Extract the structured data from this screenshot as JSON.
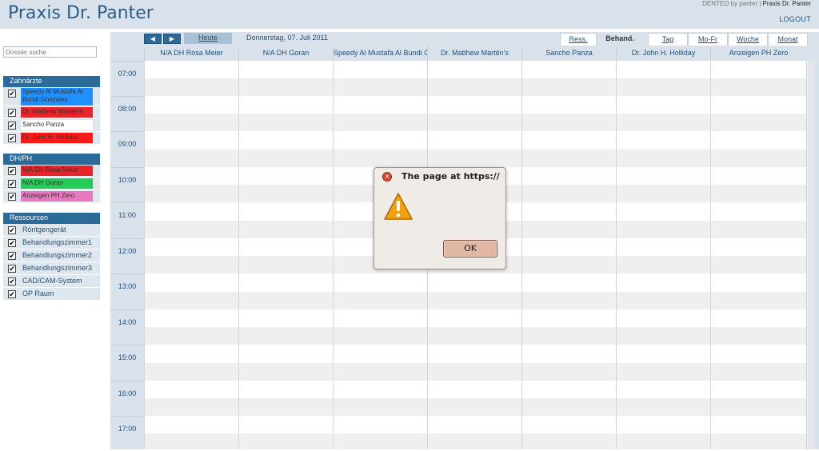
{
  "header": {
    "title": "Praxis Dr. Panter",
    "brand_prefix": "DENTEO by panter",
    "brand_sep": " | ",
    "brand_name": "Praxis Dr. Panter",
    "logout": "LOGOUT"
  },
  "sidebar": {
    "search_placeholder": "Dossier suche",
    "groups": [
      {
        "title": "Zahnärzte",
        "items": [
          {
            "label": "Speedy Al Mustafa Al Bundi Gonzales",
            "color": "#1e90ff",
            "checked": "✔"
          },
          {
            "label": "Dr. Matthew Martën's",
            "color": "#e8242a",
            "checked": "✔"
          },
          {
            "label": "Sancho Panza",
            "color": "#ffffff",
            "checked": "✔"
          },
          {
            "label": "Dr. John H. Holliday",
            "color": "#ff1a1a",
            "checked": "✔"
          }
        ]
      },
      {
        "title": "DH/PH",
        "items": [
          {
            "label": "N/A DH Rosa Meier",
            "color": "#e8242a",
            "checked": "✔"
          },
          {
            "label": "N/A DH Goran",
            "color": "#22cc55",
            "checked": "✔"
          },
          {
            "label": "Anzeigen PH Zero",
            "color": "#e879c0",
            "checked": "✔"
          }
        ]
      },
      {
        "title": "Ressourcen",
        "items": [
          {
            "label": "Röntgengerät",
            "checked": "✔"
          },
          {
            "label": "Behandlungszimmer1",
            "checked": "✔"
          },
          {
            "label": "Behandlungszimmer2",
            "checked": "✔"
          },
          {
            "label": "Behandlungszimmer3",
            "checked": "✔"
          },
          {
            "label": "CAD/CAM-System",
            "checked": "✔"
          },
          {
            "label": "OP Raum",
            "checked": "✔"
          }
        ]
      }
    ]
  },
  "calendar": {
    "prev": "◀",
    "next": "▶",
    "today": "Heute",
    "date": "Donnerstag, 07. Juli 2011",
    "view_tabs": [
      "Ress.",
      "Behand."
    ],
    "range_tabs": [
      "Tag",
      "Mo-Fr",
      "Woche",
      "Monat"
    ],
    "columns": [
      "N/A DH Rosa Meier",
      "N/A DH Goran",
      "Speedy Al Mustafa Al Bundi Gonzales",
      "Dr. Matthew Martën's",
      "Sancho Panza",
      "Dr. John H. Holliday",
      "Anzeigen PH Zero"
    ],
    "times": [
      "07:00",
      "08:00",
      "09:00",
      "10:00",
      "11:00",
      "12:00",
      "13:00",
      "14:00",
      "15:00",
      "16:00",
      "17:00"
    ]
  },
  "dialog": {
    "title": "The page at https://",
    "ok": "OK",
    "close_glyph": "×"
  }
}
